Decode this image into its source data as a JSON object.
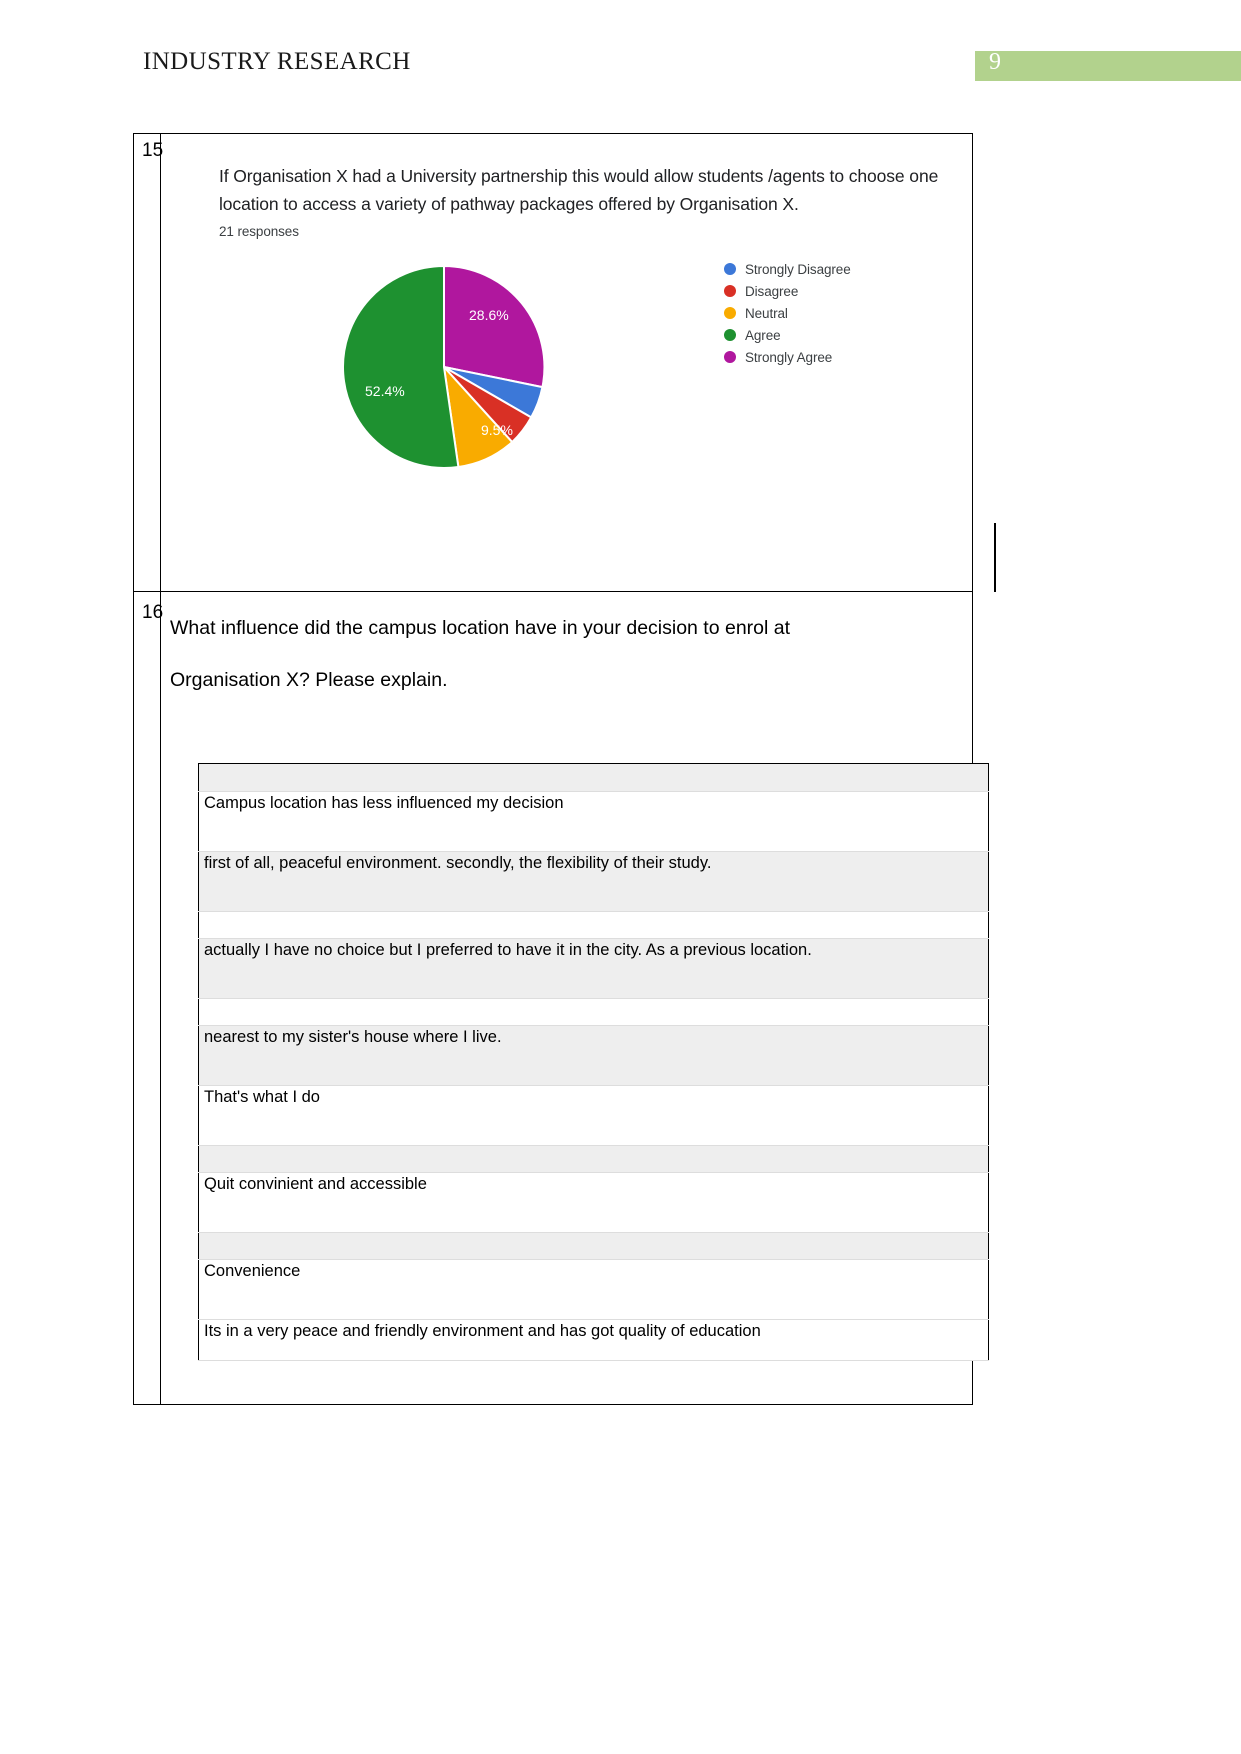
{
  "header": {
    "title": "INDUSTRY RESEARCH",
    "page_number": "9",
    "badge_color": "#b2d28d"
  },
  "chart_question": {
    "number": "15",
    "text": "If Organisation X had a University partnership this would allow students /agents to choose one location to access a variety of pathway packages offered by Organisation X.",
    "responses": "21 responses"
  },
  "chart_data": {
    "type": "pie",
    "title": "If Organisation X had a University partnership this would allow students /agents to choose one location to access a variety of pathway packages offered by Organisation X.",
    "subtitle": "21 responses",
    "total_responses": 21,
    "legend_position": "right",
    "categories": [
      "Strongly Disagree",
      "Disagree",
      "Neutral",
      "Agree",
      "Strongly Agree"
    ],
    "values": [
      4.8,
      4.8,
      9.5,
      52.4,
      28.6
    ],
    "counts": [
      1,
      1,
      2,
      11,
      6
    ],
    "colors": [
      "#3c78d8",
      "#d93025",
      "#f9ab00",
      "#1e9130",
      "#b0179e"
    ],
    "visible_labels": [
      {
        "label": "52.4%",
        "slice": "Agree"
      },
      {
        "label": "28.6%",
        "slice": "Strongly Agree"
      },
      {
        "label": "9.5%",
        "slice": "Neutral"
      }
    ],
    "legend": [
      {
        "label": "Strongly Disagree",
        "color": "#3c78d8"
      },
      {
        "label": "Disagree",
        "color": "#d93025"
      },
      {
        "label": "Neutral",
        "color": "#f9ab00"
      },
      {
        "label": "Agree",
        "color": "#1e9130"
      },
      {
        "label": "Strongly Agree",
        "color": "#b0179e"
      }
    ]
  },
  "open_question": {
    "number": "16",
    "line1": "What influence did the campus location have in your decision to enrol at",
    "line2": "Organisation X? Please explain."
  },
  "responses_table": {
    "header_label": "",
    "rows": [
      {
        "text": "Campus location has less influenced my decision",
        "shade": "white"
      },
      {
        "text": "first of all, peaceful environment. secondly, the flexibility of their study.",
        "shade": "grey"
      },
      {
        "text": "",
        "shade": "white"
      },
      {
        "text": "actually I have no choice but I preferred to have it in the city. As a previous location.",
        "shade": "grey"
      },
      {
        "text": "",
        "shade": "white"
      },
      {
        "text": "nearest to my sister's house where I live.",
        "shade": "grey"
      },
      {
        "text": "That's what I do",
        "shade": "white"
      },
      {
        "text": "",
        "shade": "grey"
      },
      {
        "text": "Quit convinient and accessible",
        "shade": "white"
      },
      {
        "text": "",
        "shade": "grey"
      },
      {
        "text": "Convenience",
        "shade": "white"
      },
      {
        "text": "Its in a very peace and friendly environment and has got quality of education",
        "shade": "white"
      }
    ]
  }
}
